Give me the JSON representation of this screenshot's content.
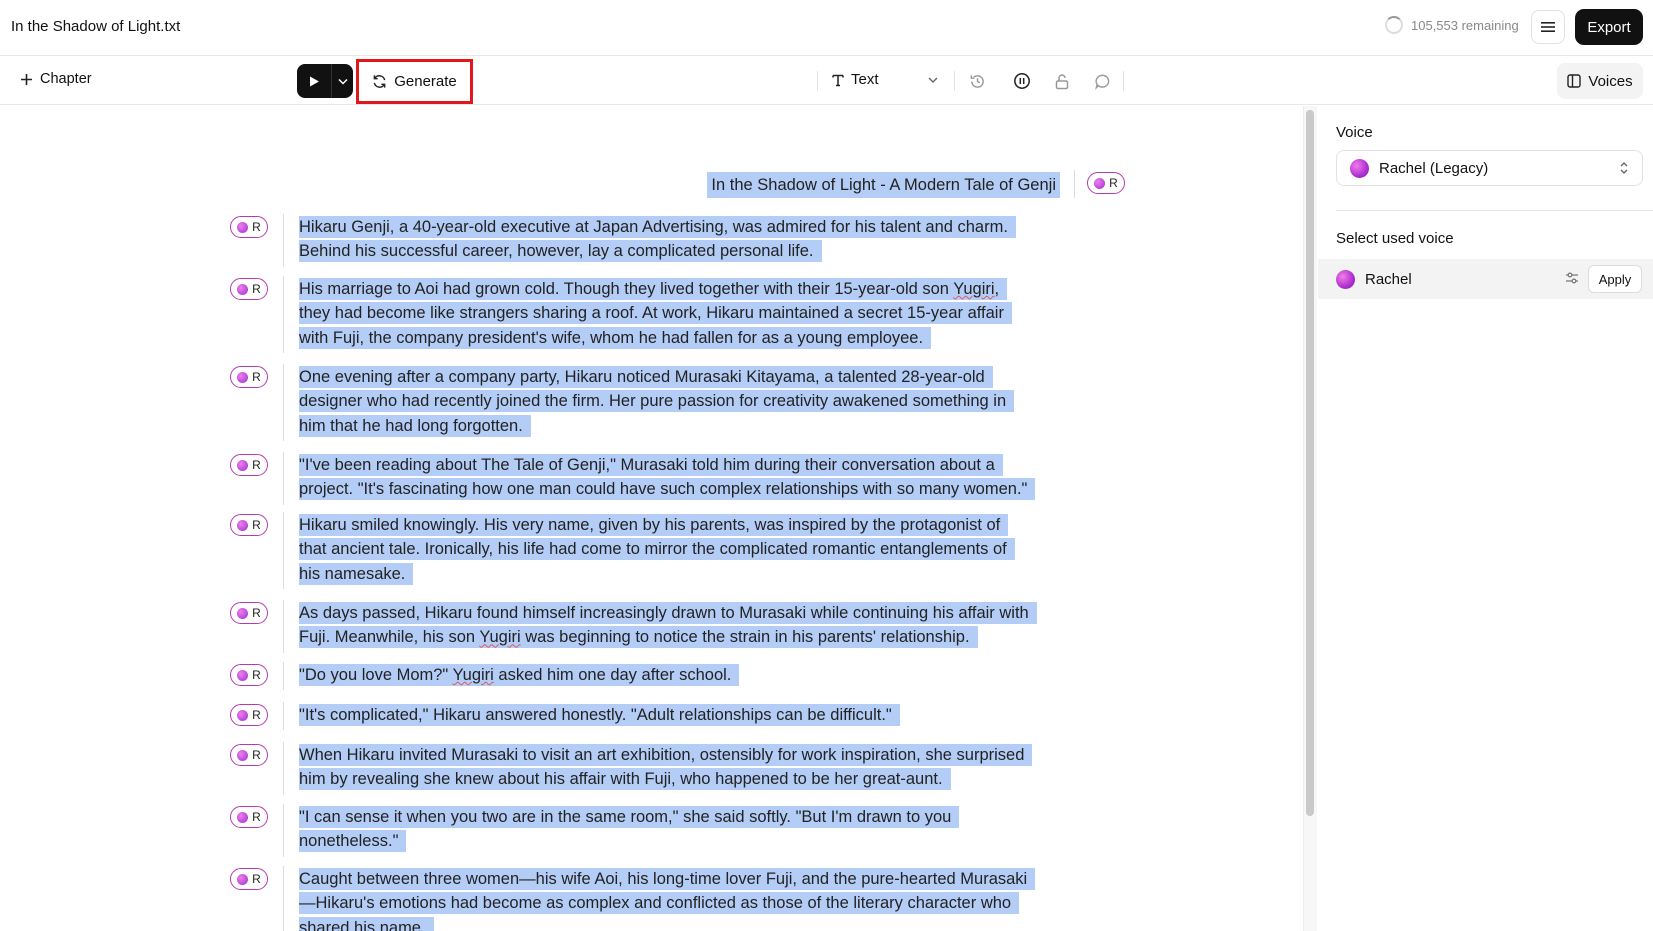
{
  "app": {
    "file_title": "In the Shadow of Light.txt",
    "remaining": "105,553 remaining",
    "export_label": "Export"
  },
  "toolbar": {
    "chapter_label": "Chapter",
    "generate_label": "Generate",
    "text_mode_label": "Text",
    "voices_label": "Voices"
  },
  "editor": {
    "title": "In the Shadow of Light - A Modern Tale of Genji",
    "speaker_initial": "R",
    "paragraphs": [
      [
        "Hikaru Genji, a 40-year-old executive at Japan Advertising, was admired for his talent and charm.",
        "Behind his successful career, however, lay a complicated personal life."
      ],
      [
        "His marriage to Aoi had grown cold. Though they lived together with their 15-year-old son Yugiri,",
        "they had become like strangers sharing a roof. At work, Hikaru maintained a secret 15-year affair",
        "with Fuji, the company president's wife, whom he had fallen for as a young employee."
      ],
      [
        "One evening after a company party, Hikaru noticed Murasaki Kitayama, a talented 28-year-old",
        "designer who had recently joined the firm. Her pure passion for creativity awakened something in",
        "him that he had long forgotten."
      ],
      [
        "\"I've been reading about The Tale of Genji,\" Murasaki told him during their conversation about a",
        "project. \"It's fascinating how one man could have such complex relationships with so many women.\""
      ],
      [
        "Hikaru smiled knowingly. His very name, given by his parents, was inspired by the protagonist of",
        "that ancient tale. Ironically, his life had come to mirror the complicated romantic entanglements of",
        "his namesake."
      ],
      [
        "As days passed, Hikaru found himself increasingly drawn to Murasaki while continuing his affair with",
        "Fuji. Meanwhile, his son Yugiri was beginning to notice the strain in his parents' relationship."
      ],
      [
        "\"Do you love Mom?\" Yugiri asked him one day after school."
      ],
      [
        "\"It's complicated,\" Hikaru answered honestly. \"Adult relationships can be difficult.\""
      ],
      [
        "When Hikaru invited Murasaki to visit an art exhibition, ostensibly for work inspiration, she surprised",
        "him by revealing she knew about his affair with Fuji, who happened to be her great-aunt."
      ],
      [
        "\"I can sense it when you two are in the same room,\" she said softly. \"But I'm drawn to you",
        "nonetheless.\""
      ],
      [
        "Caught between three women—his wife Aoi, his long-time lover Fuji, and the pure-hearted Murasaki",
        "—Hikaru's emotions had become as complex and conflicted as those of the literary character who",
        "shared his name."
      ]
    ]
  },
  "panel": {
    "voice_label": "Voice",
    "voice_selected": "Rachel (Legacy)",
    "used_label": "Select used voice",
    "used_voice_name": "Rachel",
    "apply_label": "Apply"
  },
  "colors": {
    "selection": "#b4cdf7",
    "highlight_border": "#e0171b",
    "badge_border": "#b23bb0",
    "primary_button": "#111111"
  },
  "icons": {
    "menu": "hamburger-icon",
    "chapter": "plus-icon",
    "play": "play-icon",
    "generate": "refresh-icon",
    "text_mode": "text-icon",
    "history": "history-icon",
    "pause": "pause-icon",
    "lock": "unlock-icon",
    "comment": "comment-icon",
    "voices": "sidebar-panel-icon",
    "settings": "sliders-icon"
  }
}
